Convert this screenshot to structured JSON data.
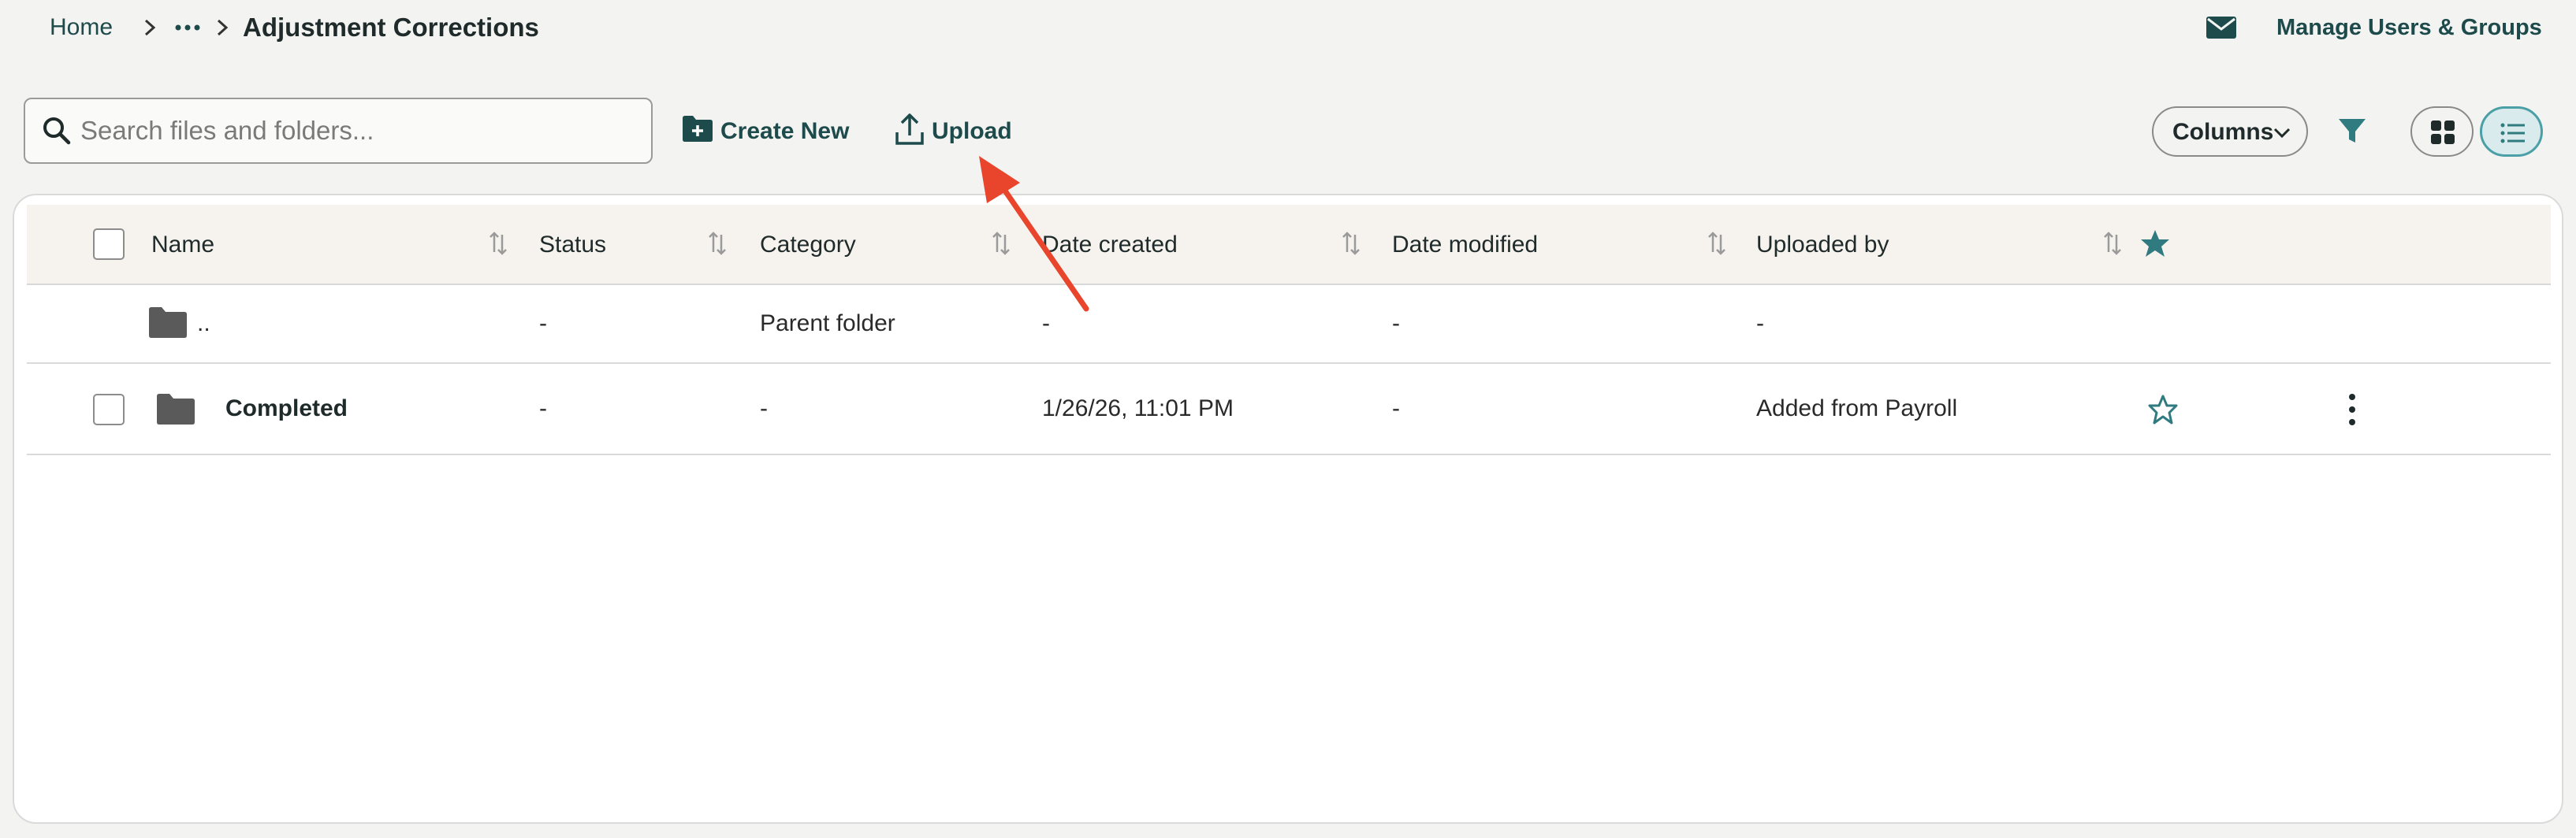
{
  "breadcrumb": {
    "home": "Home",
    "current": "Adjustment Corrections"
  },
  "header": {
    "manage_link": "Manage Users & Groups"
  },
  "toolbar": {
    "search_placeholder": "Search files and folders...",
    "create_new": "Create New",
    "upload": "Upload",
    "columns": "Columns"
  },
  "table": {
    "headers": {
      "name": "Name",
      "status": "Status",
      "category": "Category",
      "date_created": "Date created",
      "date_modified": "Date modified",
      "uploaded_by": "Uploaded by"
    },
    "rows": [
      {
        "name": "..",
        "status": "-",
        "category": "Parent folder",
        "date_created": "-",
        "date_modified": "-",
        "uploaded_by": "-"
      },
      {
        "name": "Completed",
        "status": "-",
        "category": "-",
        "date_created": "1/26/26, 11:01 PM",
        "date_modified": "-",
        "uploaded_by": "Added from Payroll"
      }
    ]
  },
  "colors": {
    "accent": "#1d4a4a",
    "teal": "#2f7b7f",
    "annotation_arrow": "#e8452c"
  }
}
